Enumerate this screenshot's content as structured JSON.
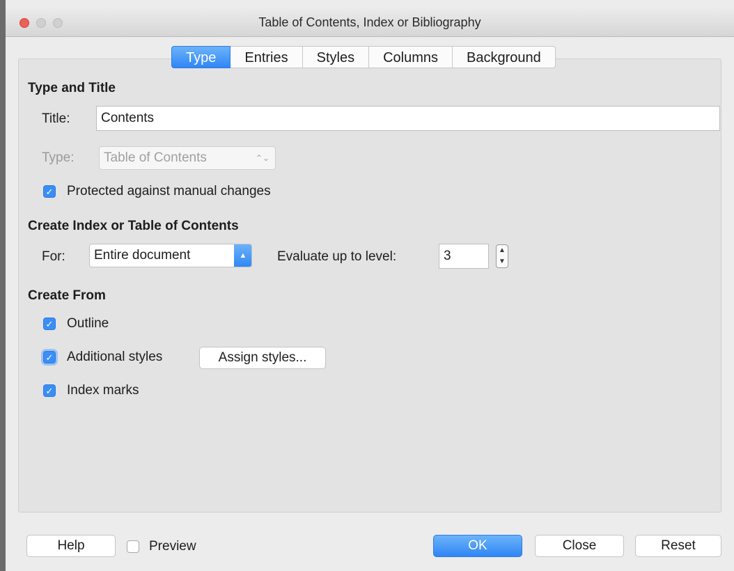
{
  "window": {
    "title": "Table of Contents, Index or Bibliography"
  },
  "tabs": [
    {
      "label": "Type",
      "active": true
    },
    {
      "label": "Entries",
      "active": false
    },
    {
      "label": "Styles",
      "active": false
    },
    {
      "label": "Columns",
      "active": false
    },
    {
      "label": "Background",
      "active": false
    }
  ],
  "type_and_title": {
    "heading": "Type and Title",
    "title_label": "Title:",
    "title_value": "Contents",
    "type_label": "Type:",
    "type_value": "Table of Contents",
    "protected_label": "Protected against manual changes",
    "protected_checked": true
  },
  "create_index": {
    "heading": "Create Index or Table of Contents",
    "for_label": "For:",
    "for_value": "Entire document",
    "level_label": "Evaluate up to level:",
    "level_value": "3"
  },
  "create_from": {
    "heading": "Create From",
    "outline_label": "Outline",
    "outline_checked": true,
    "additional_label": "Additional styles",
    "additional_checked": true,
    "assign_button": "Assign styles...",
    "index_marks_label": "Index marks",
    "index_marks_checked": true
  },
  "footer": {
    "help": "Help",
    "preview_label": "Preview",
    "preview_checked": false,
    "ok": "OK",
    "close": "Close",
    "reset": "Reset"
  },
  "colors": {
    "accent": "#2f86f5",
    "close_light": "#ee5f58",
    "background": "#ececec"
  }
}
